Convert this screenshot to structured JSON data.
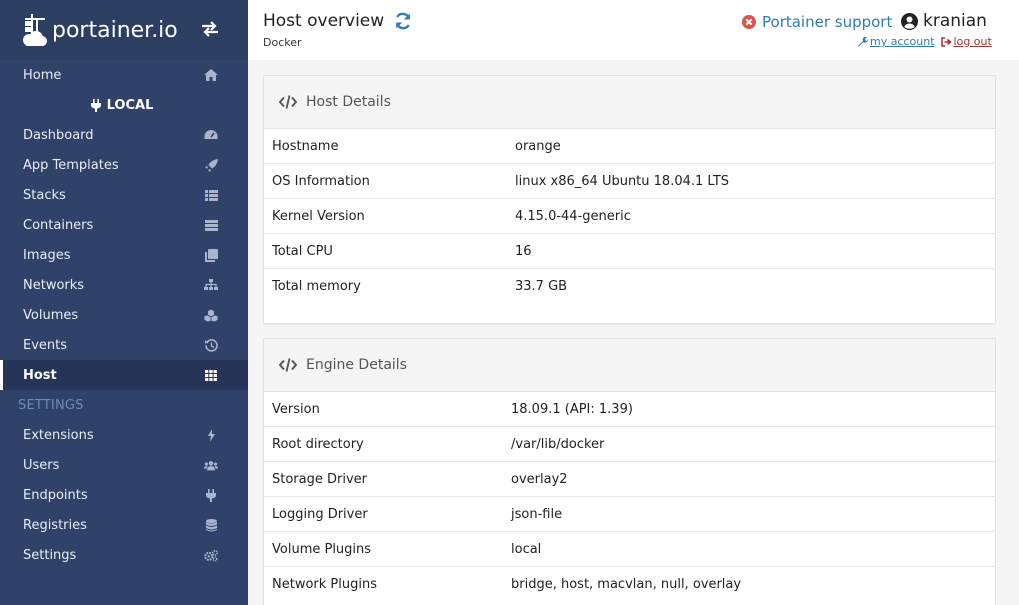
{
  "brand": {
    "name": "portainer.io"
  },
  "sidebar": {
    "items_top": [
      {
        "label": "Home",
        "icon": "home-icon"
      }
    ],
    "endpoint": "LOCAL",
    "items_endpoint": [
      {
        "label": "Dashboard",
        "icon": "tachometer-icon"
      },
      {
        "label": "App Templates",
        "icon": "rocket-icon"
      },
      {
        "label": "Stacks",
        "icon": "th-list-icon"
      },
      {
        "label": "Containers",
        "icon": "server-icon"
      },
      {
        "label": "Images",
        "icon": "clone-icon"
      },
      {
        "label": "Networks",
        "icon": "sitemap-icon"
      },
      {
        "label": "Volumes",
        "icon": "cubes-icon"
      },
      {
        "label": "Events",
        "icon": "history-icon"
      },
      {
        "label": "Host",
        "icon": "th-icon"
      }
    ],
    "settings_header": "SETTINGS",
    "items_settings": [
      {
        "label": "Extensions",
        "icon": "bolt-icon"
      },
      {
        "label": "Users",
        "icon": "users-icon"
      },
      {
        "label": "Endpoints",
        "icon": "plug-icon"
      },
      {
        "label": "Registries",
        "icon": "database-icon"
      },
      {
        "label": "Settings",
        "icon": "cogs-icon"
      }
    ]
  },
  "header": {
    "title": "Host overview",
    "breadcrumb": "Docker",
    "support": "Portainer support",
    "username": "kranian",
    "my_account": "my account",
    "log_out": "log out"
  },
  "host_details": {
    "title": "Host Details",
    "rows": [
      {
        "key": "Hostname",
        "value": "orange"
      },
      {
        "key": "OS Information",
        "value": "linux x86_64 Ubuntu 18.04.1 LTS"
      },
      {
        "key": "Kernel Version",
        "value": "4.15.0-44-generic"
      },
      {
        "key": "Total CPU",
        "value": "16"
      },
      {
        "key": "Total memory",
        "value": "33.7 GB"
      }
    ]
  },
  "engine_details": {
    "title": "Engine Details",
    "rows": [
      {
        "key": "Version",
        "value": "18.09.1 (API: 1.39)"
      },
      {
        "key": "Root directory",
        "value": "/var/lib/docker"
      },
      {
        "key": "Storage Driver",
        "value": "overlay2"
      },
      {
        "key": "Logging Driver",
        "value": "json-file"
      },
      {
        "key": "Volume Plugins",
        "value": "local"
      },
      {
        "key": "Network Plugins",
        "value": "bridge, host, macvlan, null, overlay"
      }
    ]
  },
  "colors": {
    "sidebar": "#30426a",
    "sidebar_active": "#263557",
    "accent": "#337ab7",
    "danger": "#d9534f"
  }
}
